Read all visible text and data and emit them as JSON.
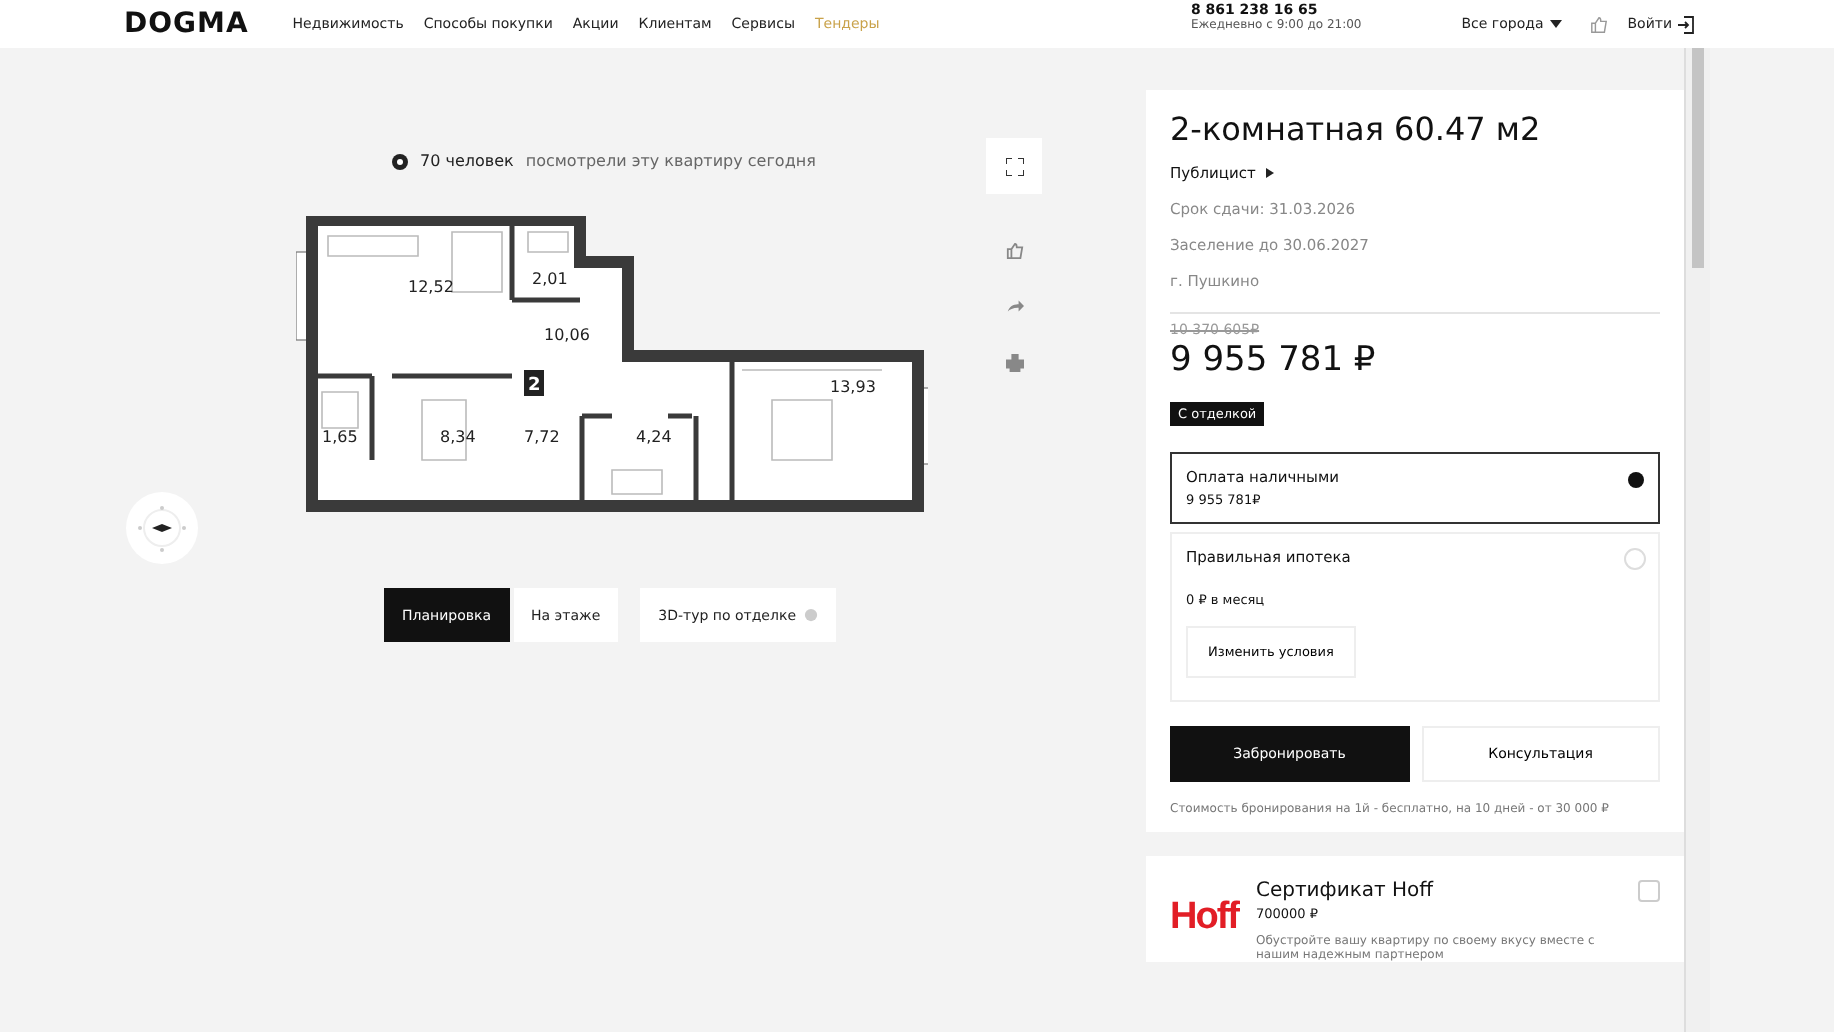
{
  "header": {
    "logo": "DOGMA",
    "nav": [
      {
        "label": "Недвижимость",
        "selected": false
      },
      {
        "label": "Способы покупки",
        "selected": false
      },
      {
        "label": "Акции",
        "selected": false
      },
      {
        "label": "Клиентам",
        "selected": false
      },
      {
        "label": "Сервисы",
        "selected": false
      },
      {
        "label": "Тендеры",
        "selected": true
      }
    ],
    "phone": "8 861 238 16 65",
    "hours": "Ежедневно с 9:00 до 21:00",
    "city": "Все города",
    "login": "Войти"
  },
  "viewers": {
    "count": "70 человек",
    "text": "посмотрели эту квартиру сегодня"
  },
  "plan": {
    "rooms": [
      "12,52",
      "2,01",
      "10,06",
      "13,93",
      "1,65",
      "8,34",
      "7,72",
      "4,24"
    ],
    "badge": "2"
  },
  "view_tabs": [
    {
      "label": "Планировка",
      "selected": true
    },
    {
      "label": "На этаже",
      "selected": false
    },
    {
      "label": "3D-тур по отделке",
      "selected": false,
      "info": true
    }
  ],
  "offer": {
    "title": "2-комнатная 60.47 м2",
    "complex": "Публицист",
    "facts": [
      "Срок сдачи: 31.03.2026",
      "Заселение до 30.06.2027",
      "г. Пушкино"
    ],
    "old_price": "10 370 605₽",
    "price": "9 955 781 ₽",
    "tag": "С отделкой",
    "payments": [
      {
        "kind": "cash",
        "title": "Оплата наличными",
        "value": "9 955 781₽",
        "selected": true
      },
      {
        "kind": "mortgage",
        "title": "Правильная ипотека",
        "value": "0 ₽ в месяц",
        "button": "Изменить условия",
        "selected": false
      }
    ],
    "book": "Забронировать",
    "consult": "Консультация",
    "note": "Стоимость бронирования на 1й - бесплатно, на 10 дней - от 30 000 ₽"
  },
  "gift": {
    "logo": "Hoff",
    "title": "Сертификат Hoff",
    "amount": "700000 ₽",
    "text": "Обустройте вашу квартиру по своему вкусу вместе с нашим надежным партнером",
    "checked": false
  }
}
